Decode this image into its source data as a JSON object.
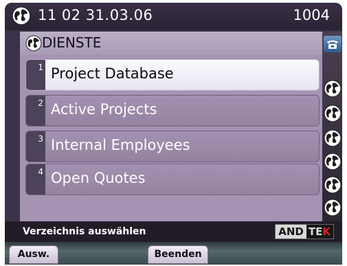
{
  "statusbar": {
    "datetime": "11 02 31.03.06",
    "extension": "1004",
    "icon": "globe-icon"
  },
  "section": {
    "title": "DIENSTE",
    "icon": "globe-icon"
  },
  "menu": {
    "selected_index": 0,
    "items": [
      {
        "number": "1",
        "label": "Project Database"
      },
      {
        "number": "2",
        "label": "Active Projects"
      },
      {
        "number": "3",
        "label": "Internal Employees"
      },
      {
        "number": "4",
        "label": "Open Quotes"
      }
    ]
  },
  "line_strip": {
    "icons": [
      "phone-icon",
      "globe-icon",
      "globe-icon",
      "globe-icon",
      "globe-icon",
      "globe-icon",
      "globe-icon"
    ]
  },
  "hint": {
    "text": "Verzeichnis auswählen"
  },
  "logo": {
    "part1": "AND",
    "part2": "TE",
    "part3": "K"
  },
  "softkeys": {
    "select_label": "Ausw.",
    "exit_label": "Beenden"
  },
  "colors": {
    "menu_background": "#a493b3",
    "selected_item": "#f4f2f8",
    "logo_accent": "#d82020"
  }
}
